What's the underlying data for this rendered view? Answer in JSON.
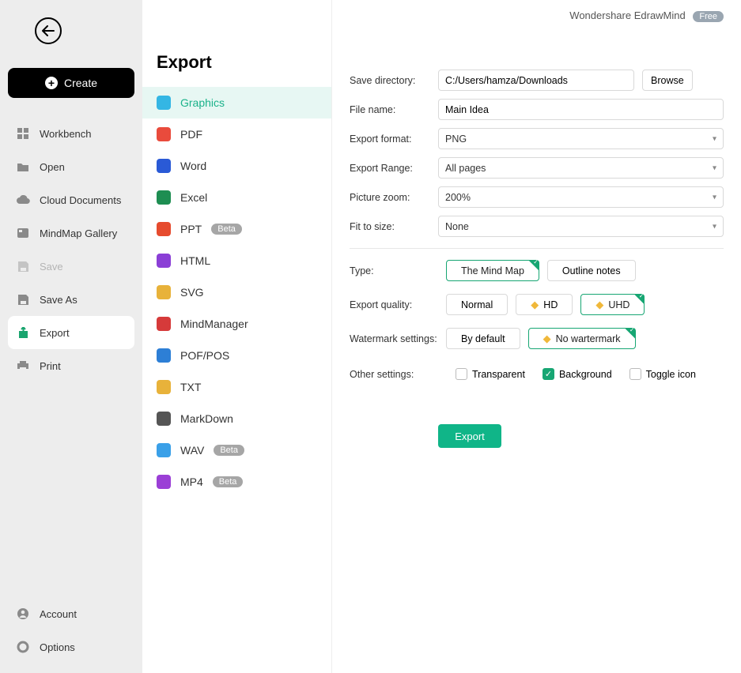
{
  "brand": {
    "name": "Wondershare EdrawMind",
    "tier": "Free"
  },
  "back": "Back",
  "create": {
    "label": "Create"
  },
  "sidebar": {
    "items": [
      {
        "label": "Workbench"
      },
      {
        "label": "Open"
      },
      {
        "label": "Cloud Documents"
      },
      {
        "label": "MindMap Gallery"
      },
      {
        "label": "Save"
      },
      {
        "label": "Save As"
      },
      {
        "label": "Export"
      },
      {
        "label": "Print"
      }
    ],
    "footer": [
      {
        "label": "Account"
      },
      {
        "label": "Options"
      }
    ]
  },
  "panel_title": "Export",
  "formats": [
    {
      "label": "Graphics",
      "color": "#34b6e4",
      "badge": null
    },
    {
      "label": "PDF",
      "color": "#e94b3c",
      "badge": null
    },
    {
      "label": "Word",
      "color": "#2a5ad6",
      "badge": null
    },
    {
      "label": "Excel",
      "color": "#1e8e52",
      "badge": null
    },
    {
      "label": "PPT",
      "color": "#e64b2e",
      "badge": "Beta"
    },
    {
      "label": "HTML",
      "color": "#8b3fd6",
      "badge": null
    },
    {
      "label": "SVG",
      "color": "#e8b23a",
      "badge": null
    },
    {
      "label": "MindManager",
      "color": "#d63a3a",
      "badge": null
    },
    {
      "label": "POF/POS",
      "color": "#2d7fd6",
      "badge": null
    },
    {
      "label": "TXT",
      "color": "#e8b23a",
      "badge": null
    },
    {
      "label": "MarkDown",
      "color": "#555555",
      "badge": null
    },
    {
      "label": "WAV",
      "color": "#3aa0e8",
      "badge": "Beta"
    },
    {
      "label": "MP4",
      "color": "#9b3fd6",
      "badge": "Beta"
    }
  ],
  "form": {
    "save_dir_label": "Save directory:",
    "save_dir_value": "C:/Users/hamza/Downloads",
    "browse": "Browse",
    "filename_label": "File name:",
    "filename_value": "Main Idea",
    "format_label": "Export format:",
    "format_value": "PNG",
    "range_label": "Export Range:",
    "range_value": "All pages",
    "zoom_label": "Picture zoom:",
    "zoom_value": "200%",
    "fit_label": "Fit to size:",
    "fit_value": "None",
    "type_label": "Type:",
    "type_options": {
      "mindmap": "The Mind Map",
      "outline": "Outline notes"
    },
    "quality_label": "Export quality:",
    "quality_options": {
      "normal": "Normal",
      "hd": "HD",
      "uhd": "UHD"
    },
    "watermark_label": "Watermark settings:",
    "watermark_options": {
      "default": "By default",
      "none": "No wartermark"
    },
    "other_label": "Other settings:",
    "other_options": {
      "transparent": "Transparent",
      "background": "Background",
      "toggle": "Toggle icon"
    }
  },
  "export_button": "Export"
}
